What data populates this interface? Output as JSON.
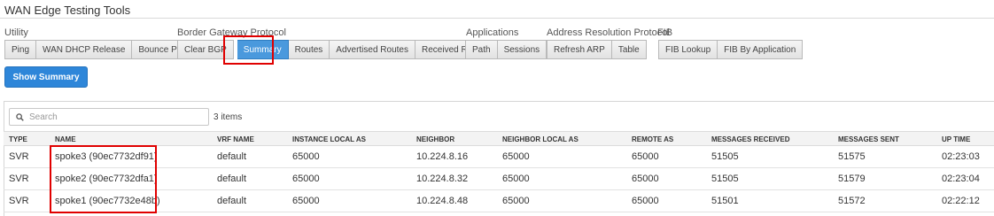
{
  "page": {
    "title": "WAN Edge Testing Tools"
  },
  "groups": [
    {
      "label": "Utility",
      "buttons": [
        "Ping",
        "WAN DHCP Release",
        "Bounce Port"
      ]
    },
    {
      "label": "Border Gateway Protocol",
      "buttons": [
        "Clear BGP",
        "Summary",
        "Routes",
        "Advertised Routes",
        "Received Routes"
      ]
    },
    {
      "label": "Applications",
      "buttons": [
        "Path",
        "Sessions"
      ]
    },
    {
      "label": "Address Resolution Protocol",
      "buttons": [
        "Refresh ARP",
        "Table"
      ]
    },
    {
      "label": "FIB",
      "buttons": [
        "FIB Lookup",
        "FIB By Application"
      ]
    }
  ],
  "active_button": "Summary",
  "action": {
    "show_summary": "Show Summary"
  },
  "search": {
    "placeholder": "Search",
    "value": ""
  },
  "item_count": "3 items",
  "table": {
    "columns": [
      "TYPE",
      "NAME",
      "VRF NAME",
      "INSTANCE LOCAL AS",
      "NEIGHBOR",
      "NEIGHBOR LOCAL AS",
      "REMOTE AS",
      "MESSAGES RECEIVED",
      "MESSAGES SENT",
      "UP TIME"
    ],
    "rows": [
      [
        "SVR",
        "spoke3 (90ec7732df91)",
        "default",
        "65000",
        "10.224.8.16",
        "65000",
        "65000",
        "51505",
        "51575",
        "02:23:03"
      ],
      [
        "SVR",
        "spoke2 (90ec7732dfa1)",
        "default",
        "65000",
        "10.224.8.32",
        "65000",
        "65000",
        "51505",
        "51579",
        "02:23:04"
      ],
      [
        "SVR",
        "spoke1 (90ec7732e48b)",
        "default",
        "65000",
        "10.224.8.48",
        "65000",
        "65000",
        "51501",
        "51572",
        "02:22:12"
      ]
    ]
  },
  "colors": {
    "accent": "#2e86d9",
    "active_button": "#4a99dd",
    "highlight": "#e00000"
  }
}
